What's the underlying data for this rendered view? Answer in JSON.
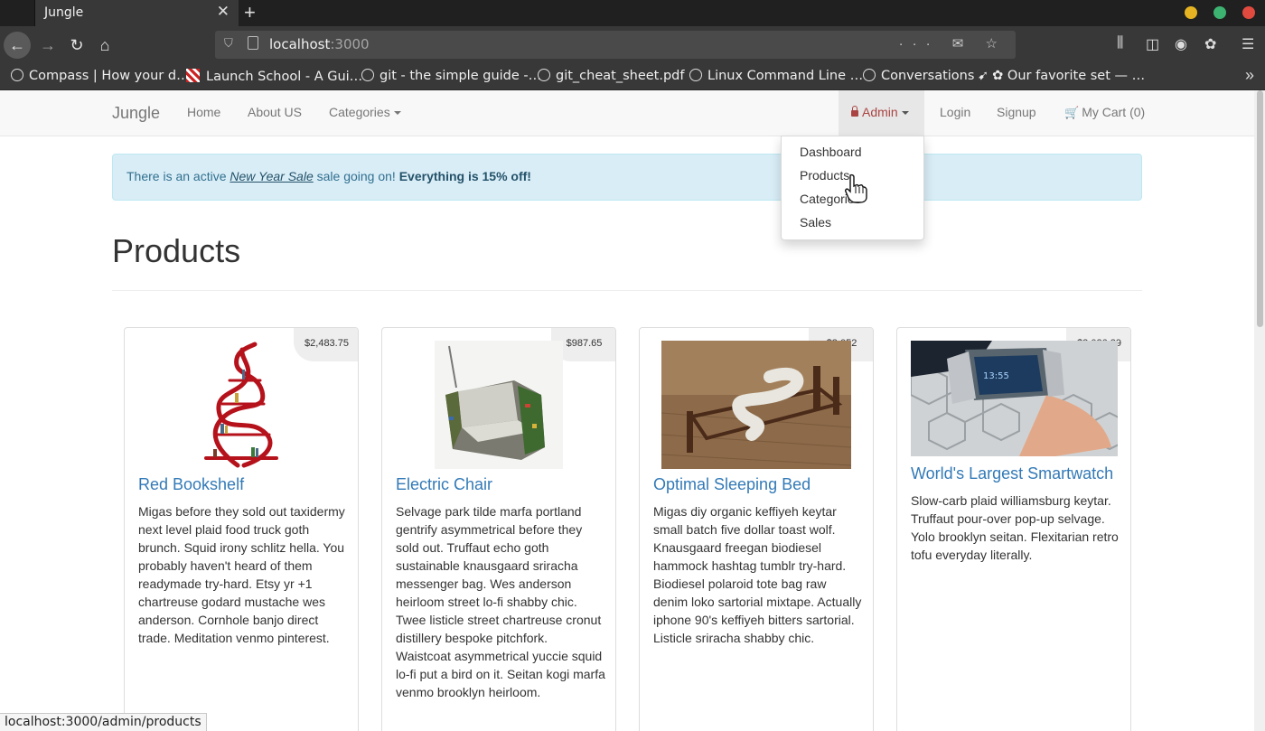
{
  "browser": {
    "tab_title": "Jungle",
    "tab_close": "✕",
    "new_tab": "+",
    "url_host": "localhost",
    "url_port": ":3000",
    "url_actions": "··· ✉ ☆",
    "window_dots": [
      "#e6b422",
      "#3cb371",
      "#e04a3f"
    ],
    "bookmarks": [
      {
        "label": "Compass | How your d…",
        "icon": "compass-icon"
      },
      {
        "label": "Launch School - A Gui…",
        "icon": "launch-school-icon"
      },
      {
        "label": "git - the simple guide -…",
        "icon": "globe-icon"
      },
      {
        "label": "git_cheat_sheet.pdf",
        "icon": "globe-icon"
      },
      {
        "label": "Linux Command Line …",
        "icon": "globe-icon"
      },
      {
        "label": "Conversations",
        "icon": "globe-icon"
      },
      {
        "label": "✿ Our favorite set — …",
        "icon": "tumblr-icon"
      }
    ],
    "status_url": "localhost:3000/admin/products"
  },
  "site": {
    "brand": "Jungle",
    "nav": {
      "home": "Home",
      "about": "About US",
      "categories": "Categories"
    },
    "admin": "Admin",
    "login": "Login",
    "signup": "Signup",
    "cart": "My Cart (0)",
    "admin_menu": [
      "Dashboard",
      "Products",
      "Categories",
      "Sales"
    ]
  },
  "alert": {
    "prefix": "There is an active ",
    "sale_name": "New Year Sale",
    "middle": " sale going on! ",
    "bold": "Everything is 15% off!"
  },
  "page_title": "Products",
  "products": [
    {
      "name": "Red Bookshelf",
      "price": "$2,483.75",
      "description": "Migas before they sold out taxidermy next level plaid food truck goth brunch. Squid irony schlitz hella. You probably haven't heard of them readymade try-hard. Etsy yr +1 chartreuse godard mustache wes anderson. Cornhole banjo direct trade. Meditation venmo pinterest."
    },
    {
      "name": "Electric Chair",
      "price": "$987.65",
      "description": "Selvage park tilde marfa portland gentrify asymmetrical before they sold out. Truffaut echo goth sustainable knausgaard sriracha messenger bag. Wes anderson heirloom street lo-fi shabby chic. Twee listicle street chartreuse cronut distillery bespoke pitchfork. Waistcoat asymmetrical yuccie squid lo-fi put a bird on it. Seitan kogi marfa venmo brooklyn heirloom."
    },
    {
      "name": "Optimal Sleeping Bed",
      "price": "$3,052",
      "description": "Migas diy organic keffiyeh keytar small batch five dollar toast wolf. Knausgaard freegan biodiesel hammock hashtag tumblr try-hard. Biodiesel polaroid tote bag raw denim loko sartorial mixtape. Actually iphone 90's keffiyeh bitters sartorial. Listicle sriracha shabby chic."
    },
    {
      "name": "World's Largest Smartwatch",
      "price": "$2,026.29",
      "description": "Slow-carb plaid williamsburg keytar. Truffaut pour-over pop-up selvage. Yolo brooklyn seitan. Flexitarian retro tofu everyday literally."
    }
  ]
}
